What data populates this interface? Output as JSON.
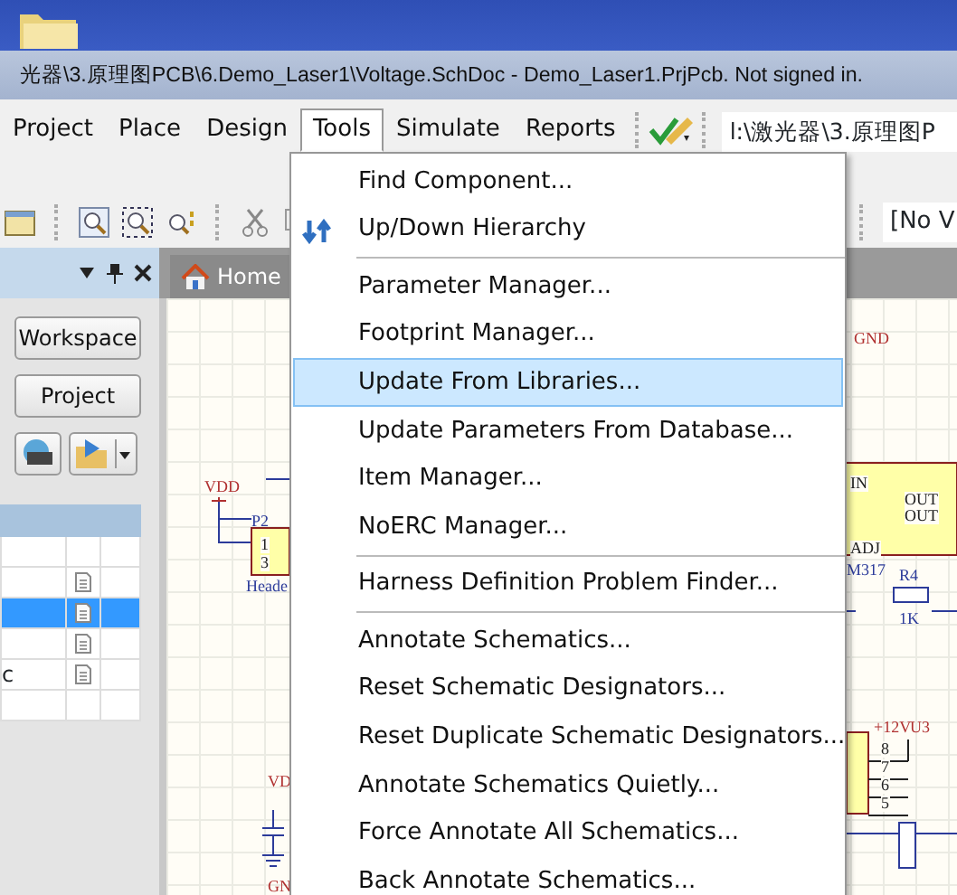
{
  "title_bar": {
    "title": "光器\\3.原理图PCB\\6.Demo_Laser1\\Voltage.SchDoc - Demo_Laser1.PrjPcb. Not signed in."
  },
  "menu_bar": {
    "items": [
      {
        "label": "Project",
        "open": false
      },
      {
        "label": "Place",
        "open": false
      },
      {
        "label": "Design",
        "open": false
      },
      {
        "label": "Tools",
        "open": true
      },
      {
        "label": "Simulate",
        "open": false
      },
      {
        "label": "Reports",
        "open": false
      }
    ],
    "path_field": "l:\\激光器\\3.原理图P"
  },
  "toolbar": {
    "view_field": "[No V"
  },
  "document_tabs": [
    {
      "label": "Home"
    }
  ],
  "panel": {
    "buttons": [
      "Workspace",
      "Project"
    ],
    "rows": [
      {
        "has_doc": false,
        "selected": false
      },
      {
        "has_doc": true,
        "selected": false
      },
      {
        "has_doc": true,
        "selected": true
      },
      {
        "has_doc": true,
        "selected": false
      },
      {
        "text": "c",
        "has_doc": true,
        "selected": false
      },
      {
        "has_doc": false,
        "selected": false
      }
    ]
  },
  "tools_menu": {
    "groups": [
      [
        {
          "label": "Find Component...",
          "has_icon": false,
          "selected": false
        },
        {
          "label": "Up/Down Hierarchy",
          "has_icon": true,
          "selected": false
        }
      ],
      [
        {
          "label": "Parameter Manager...",
          "has_icon": false,
          "selected": false
        },
        {
          "label": "Footprint Manager...",
          "has_icon": false,
          "selected": false
        },
        {
          "label": "Update From Libraries...",
          "has_icon": false,
          "selected": true
        },
        {
          "label": "Update Parameters From Database...",
          "has_icon": false,
          "selected": false
        },
        {
          "label": "Item Manager...",
          "has_icon": false,
          "selected": false
        },
        {
          "label": "NoERC Manager...",
          "has_icon": false,
          "selected": false
        }
      ],
      [
        {
          "label": "Harness Definition Problem Finder...",
          "has_icon": false,
          "selected": false
        }
      ],
      [
        {
          "label": "Annotate Schematics...",
          "has_icon": false,
          "selected": false
        },
        {
          "label": "Reset Schematic Designators...",
          "has_icon": false,
          "selected": false
        },
        {
          "label": "Reset Duplicate Schematic Designators...",
          "has_icon": false,
          "selected": false
        },
        {
          "label": "Annotate Schematics Quietly...",
          "has_icon": false,
          "selected": false
        },
        {
          "label": "Force Annotate All Schematics...",
          "has_icon": false,
          "selected": false
        },
        {
          "label": "Back Annotate Schematics...",
          "has_icon": false,
          "selected": false
        }
      ]
    ]
  },
  "schematic": {
    "labels": [
      {
        "text": "GND",
        "kind": "net"
      },
      {
        "text": "VDD",
        "kind": "net"
      },
      {
        "text": "P2",
        "kind": "part"
      },
      {
        "text": "1",
        "kind": "pin"
      },
      {
        "text": "3",
        "kind": "pin"
      },
      {
        "text": "Heade",
        "kind": "part"
      },
      {
        "text": "IN",
        "kind": "pin"
      },
      {
        "text": "OUT",
        "kind": "pin"
      },
      {
        "text": "OUT",
        "kind": "pin"
      },
      {
        "text": "ADJ",
        "kind": "pin"
      },
      {
        "text": "M317",
        "kind": "part"
      },
      {
        "text": "R4",
        "kind": "part"
      },
      {
        "text": "1K",
        "kind": "part"
      },
      {
        "text": "+12V",
        "kind": "net"
      },
      {
        "text": "U3",
        "kind": "net"
      },
      {
        "text": "8",
        "kind": "pin"
      },
      {
        "text": "7",
        "kind": "pin"
      },
      {
        "text": "6",
        "kind": "pin"
      },
      {
        "text": "5",
        "kind": "pin"
      },
      {
        "text": "VD",
        "kind": "net"
      },
      {
        "text": "GN",
        "kind": "net"
      }
    ]
  }
}
